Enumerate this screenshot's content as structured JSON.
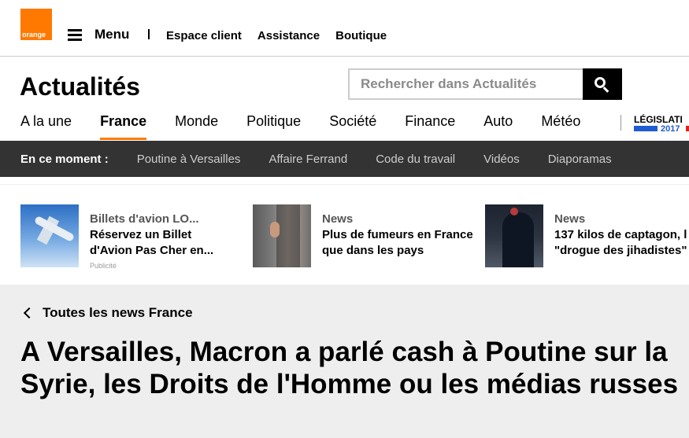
{
  "topbar": {
    "logo_text": "orange",
    "menu_label": "Menu",
    "links": [
      "Espace client",
      "Assistance",
      "Boutique"
    ]
  },
  "header": {
    "title": "Actualités",
    "search_placeholder": "Rechercher dans Actualités"
  },
  "nav": {
    "items": [
      "A la une",
      "France",
      "Monde",
      "Politique",
      "Société",
      "Finance",
      "Auto",
      "Météo"
    ],
    "active": "France",
    "legislatives_label": "LÉGISLATI",
    "legislatives_year": "2017"
  },
  "moment": {
    "label": "En ce moment :",
    "links": [
      "Poutine à Versailles",
      "Affaire Ferrand",
      "Code du travail",
      "Vidéos",
      "Diaporamas"
    ]
  },
  "promo": [
    {
      "kicker": "Billets d'avion LO...",
      "headline": "Réservez un Billet d'Avion Pas Cher en...",
      "sponsored": "Publicité"
    },
    {
      "kicker": "News",
      "headline": "Plus de fumeurs en France que dans les pays"
    },
    {
      "kicker": "News",
      "headline": "137 kilos de captagon, l \"drogue des jihadistes\""
    }
  ],
  "article": {
    "back_label": "Toutes les news France",
    "title": "A Versailles, Macron a parlé cash à Poutine sur la Syrie, les Droits de l'Homme ou les médias russes"
  },
  "colors": {
    "brand": "#ff7900",
    "dark_bar": "#333333",
    "legislatives_blue": "#1f5bd1",
    "legislatives_red": "#e2231a"
  },
  "icons": [
    "orange-logo",
    "hamburger-icon",
    "search-icon",
    "ad-choices-icon",
    "chevron-left-icon"
  ]
}
